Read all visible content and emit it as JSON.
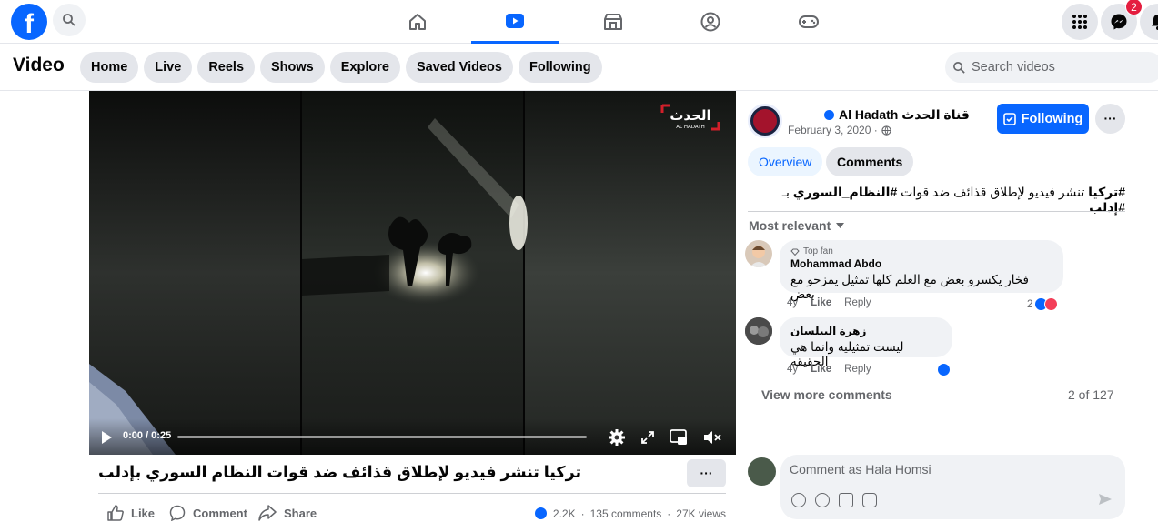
{
  "colors": {
    "accent": "#0866ff",
    "badge": "#e41e3f",
    "muted": "#65676b",
    "chip_bg": "#e4e6eb"
  },
  "topbar": {
    "logo": "f",
    "nav_icons": [
      "home-icon",
      "video-icon",
      "marketplace-icon",
      "groups-icon",
      "gaming-icon"
    ],
    "active_tab": "video-icon",
    "right_icons": [
      "menu-grid-icon",
      "messenger-icon",
      "notifications-icon"
    ],
    "messenger_badge": "2"
  },
  "subheader": {
    "title": "Video",
    "chips": [
      "Home",
      "Live",
      "Reels",
      "Shows",
      "Explore",
      "Saved Videos",
      "Following"
    ],
    "search_placeholder": "Search videos"
  },
  "player": {
    "time": "0:00 / 0:25",
    "progress": 0,
    "watermark": "الحدث AL HADATH"
  },
  "video": {
    "title": "تركيا تنشر فيديو لإطلاق قذائف ضد قوات النظام السوري بإدلب",
    "more": "···",
    "actions": {
      "like": "Like",
      "comment": "Comment",
      "share": "Share"
    },
    "stats": {
      "reactions": "2.2K",
      "comments": "135 comments",
      "views": "27K views",
      "sep": "·"
    }
  },
  "panel": {
    "page_name": "Al Hadath قناة الحدث",
    "date": "February 3, 2020 ·",
    "following": "Following",
    "more": "···",
    "tabs": [
      "Overview",
      "Comments"
    ],
    "caption_parts": [
      "#تركيا",
      " تنشر فيديو لإطلاق قذائف ضد قوات ",
      "#النظام_السوري",
      " بـ ",
      "#إدلب"
    ],
    "sort": "Most relevant",
    "comments": [
      {
        "badge": "Top fan",
        "name": "Mohammad Abdo",
        "text": "فخار يكسرو بعض مع العلم كلها تمثيل يمزحو مع بعض",
        "age": "4y",
        "like": "Like",
        "reply": "Reply",
        "reactions": "2"
      },
      {
        "name": "زهرة البيلسان",
        "text": "ليست تمثيليه وانما هي الحقيقه",
        "age": "4y",
        "like": "Like",
        "reply": "Reply"
      }
    ],
    "view_more": "View more comments",
    "count": "2 of 127",
    "compose_placeholder": "Comment as Hala Homsi"
  }
}
